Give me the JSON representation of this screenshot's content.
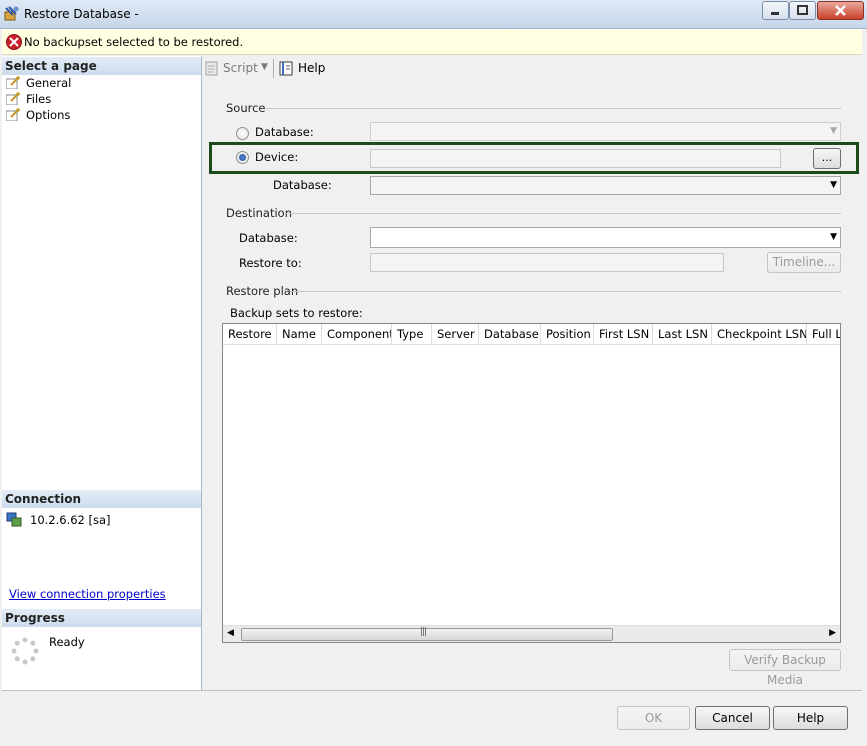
{
  "window": {
    "title": "Restore Database -",
    "minimize_label": "",
    "maximize_label": "",
    "close_label": ""
  },
  "banner": {
    "message": "No backupset selected to be restored."
  },
  "left_panel": {
    "select_page_header": "Select a page",
    "pages": [
      {
        "label": "General"
      },
      {
        "label": "Files"
      },
      {
        "label": "Options"
      }
    ],
    "connection_header": "Connection",
    "connection_server": "10.2.6.62 [sa]",
    "connection_link": "View connection properties",
    "progress_header": "Progress",
    "progress_status": "Ready"
  },
  "toolbar": {
    "script_label": "Script",
    "help_label": "Help"
  },
  "source": {
    "group_label": "Source",
    "database_radio_label": "Database:",
    "device_radio_label": "Device:",
    "device_browse_label": "...",
    "database_label": "Database:",
    "selected": "device"
  },
  "destination": {
    "group_label": "Destination",
    "database_label": "Database:",
    "restore_to_label": "Restore to:",
    "timeline_label": "Timeline..."
  },
  "restore_plan": {
    "group_label": "Restore plan",
    "backup_sets_label": "Backup sets to restore:",
    "columns": [
      "Restore",
      "Name",
      "Component",
      "Type",
      "Server",
      "Database",
      "Position",
      "First LSN",
      "Last LSN",
      "Checkpoint LSN",
      "Full LS"
    ],
    "verify_label": "Verify Backup Media"
  },
  "buttons": {
    "ok": "OK",
    "cancel": "Cancel",
    "help": "Help"
  },
  "colors": {
    "highlight_border": "#1b4a1b",
    "error_icon": "#c8202a",
    "link": "#0000cc"
  }
}
